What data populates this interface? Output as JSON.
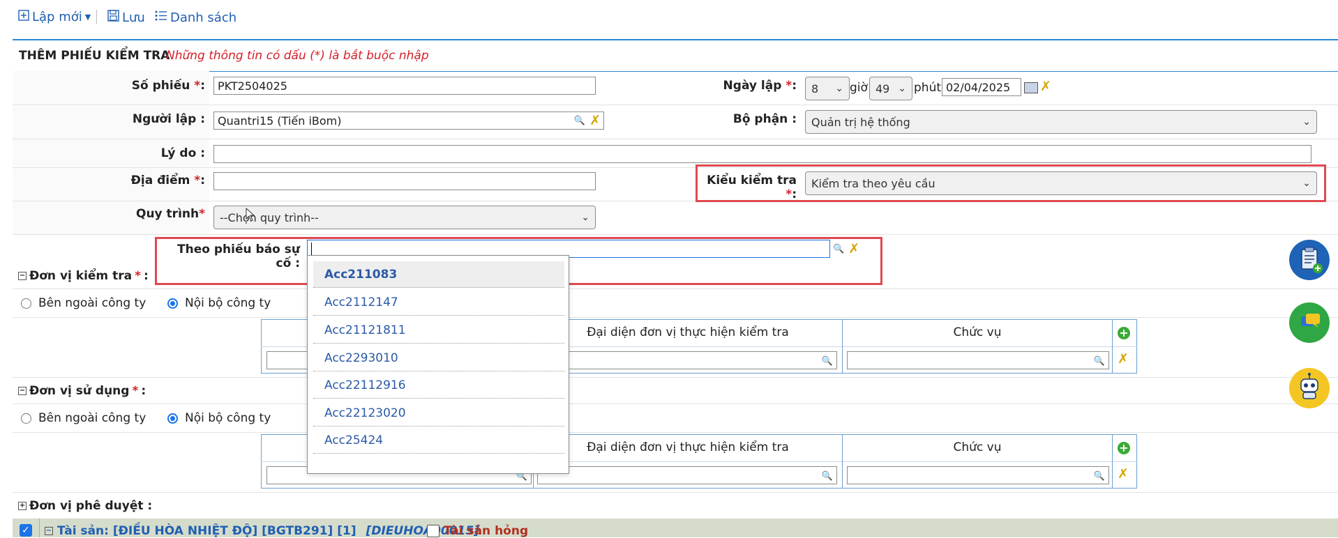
{
  "toolbar": {
    "new_label": "Lập mới",
    "save_label": "Lưu",
    "list_label": "Danh sách"
  },
  "form": {
    "title": "THÊM PHIẾU KIỂM TRA",
    "required_note": "Những thông tin có dấu (*) là bắt buộc nhập",
    "so_phieu_label": "Số phiếu",
    "so_phieu_value": "PKT2504025",
    "ngay_lap_label": "Ngày lập",
    "hour_value": "8",
    "hour_label": "giờ",
    "minute_value": "49",
    "minute_label": "phút",
    "date_value": "02/04/2025",
    "nguoi_lap_label": "Người lập :",
    "nguoi_lap_value": "Quantri15 (Tiến iBom)",
    "bo_phan_label": "Bộ phận :",
    "bo_phan_value": "Quản trị hệ thống",
    "ly_do_label": "Lý do :",
    "dia_diem_label": "Địa điểm",
    "kieu_kiem_tra_label": "Kiểu kiểm tra",
    "kieu_kiem_tra_value": "Kiểm tra theo yêu cầu",
    "quy_trinh_label": "Quy trình",
    "quy_trinh_value": "--Chọn quy trình--",
    "theo_phieu_label": "Theo phiếu báo sự cố :",
    "required_mark": "*",
    "colon": ":"
  },
  "dropdown": {
    "items": [
      "Acc211083",
      "Acc2112147",
      "Acc21121811",
      "Acc2293010",
      "Acc22112916",
      "Acc22123020",
      "Acc25424"
    ]
  },
  "don_vi_kiem_tra": {
    "label": "Đơn vị kiểm tra",
    "radio_outside": "Bên ngoài công ty",
    "radio_inside": "Nội bộ công ty",
    "col_representative": "Đại diện đơn vị thực hiện kiểm tra",
    "col_position": "Chức vụ"
  },
  "don_vi_su_dung": {
    "label": "Đơn vị sử dụng",
    "radio_outside": "Bên ngoài công ty",
    "radio_inside": "Nội bộ công ty",
    "col_representative": "Đại diện đơn vị thực hiện kiểm tra",
    "col_position": "Chức vụ"
  },
  "don_vi_phe_duyet": {
    "label": "Đơn vị phê duyệt :"
  },
  "asset_row": {
    "label": "Tài sản: [ĐIỀU HÒA NHIỆT ĐỘ] [BGTB291] [1]",
    "code": "[DIEUHOA00015]",
    "damaged_label": "Tài sản hỏng"
  },
  "colors": {
    "link_blue": "#1f5fb2",
    "required_red": "#d4202a",
    "highlight_red": "#e0484f",
    "accent_blue": "#2a86d4"
  }
}
